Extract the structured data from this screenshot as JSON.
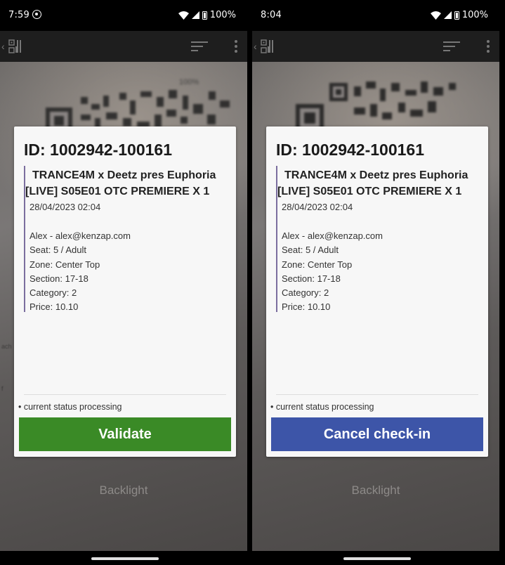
{
  "left": {
    "status": {
      "time": "7:59",
      "battery": "100%"
    },
    "ticket": {
      "id_label": "ID: 1002942-100161",
      "event_line1": "TRANCE4M x Deetz pres Euphoria",
      "event_line2": "[LIVE] S05E01 OTC PREMIERE X 1",
      "date": "28/04/2023 02:04",
      "holder": "Alex - alex@kenzap.com",
      "seat": "Seat: 5 / Adult",
      "zone": "Zone: Center Top",
      "section": "Section: 17-18",
      "category": "Category: 2",
      "price": "Price: 10.10"
    },
    "status_text": "• current status processing",
    "action_label": "Validate",
    "backlight_label": "Backlight"
  },
  "right": {
    "status": {
      "time": "8:04",
      "battery": "100%"
    },
    "ticket": {
      "id_label": "ID: 1002942-100161",
      "event_line1": "TRANCE4M x Deetz pres Euphoria",
      "event_line2": "[LIVE] S05E01 OTC PREMIERE X 1",
      "date": "28/04/2023 02:04",
      "holder": "Alex - alex@kenzap.com",
      "seat": "Seat: 5 / Adult",
      "zone": "Zone: Center Top",
      "section": "Section: 17-18",
      "category": "Category: 2",
      "price": "Price: 10.10"
    },
    "status_text": "• current status processing",
    "action_label": "Cancel check-in",
    "backlight_label": "Backlight"
  },
  "colors": {
    "validate": "#3a8a26",
    "cancel": "#3d55a8",
    "card_accent": "#7b6e9e"
  },
  "icons": [
    "whatsapp-icon",
    "wifi-icon",
    "signal-icon",
    "battery-icon",
    "back-arrow-icon",
    "qr-code-icon",
    "filter-icon",
    "more-vert-icon"
  ]
}
